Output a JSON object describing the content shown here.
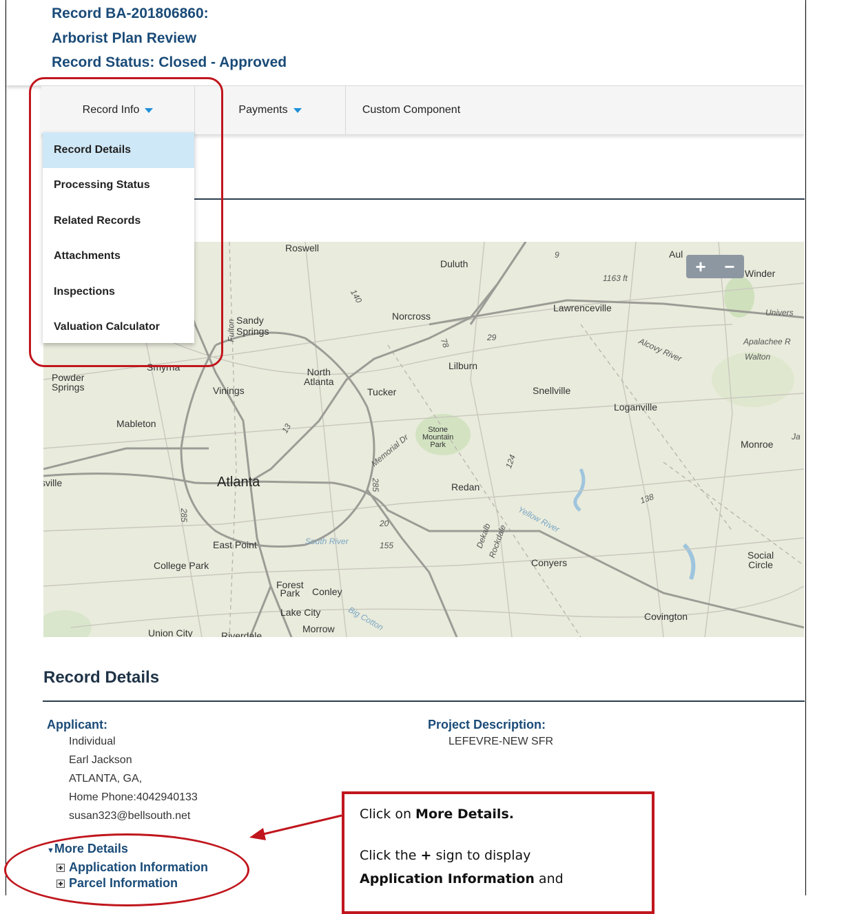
{
  "header": {
    "record_id": "Record BA-201806860:",
    "record_type": "Arborist Plan Review",
    "record_status": "Record Status: Closed - Approved"
  },
  "tabs": [
    {
      "label": "Record Info",
      "has_caret": true
    },
    {
      "label": "Payments",
      "has_caret": true
    },
    {
      "label": "Custom Component",
      "has_caret": false
    }
  ],
  "dropdown": {
    "items": [
      {
        "label": "Record Details",
        "active": true
      },
      {
        "label": "Processing Status"
      },
      {
        "label": "Related Records"
      },
      {
        "label": "Attachments"
      },
      {
        "label": "Inspections"
      },
      {
        "label": "Valuation Calculator"
      }
    ]
  },
  "map": {
    "labels": {
      "roswell": "Roswell",
      "duluth": "Duluth",
      "aul": "Aul",
      "winder": "Winder",
      "elev": "1163 ft",
      "lawrenceville": "Lawrenceville",
      "norcross": "Norcross",
      "sandy_springs": "Sandy\nSprings",
      "univers": "Univers",
      "apalachee": "Apalachee R",
      "walton": "Walton",
      "alcovy": "Alcovy River",
      "lilburn": "Lilburn",
      "smyrna": "Smyrna",
      "north_atlanta": "North\nAtlanta",
      "powder_springs": "Powder\nSprings",
      "vinings": "Vinings",
      "tucker": "Tucker",
      "snellville": "Snellville",
      "loganville": "Loganville",
      "mableton": "Mableton",
      "stone_mountain": "Stone\nMountain\nPark",
      "monroe": "Monroe",
      "ja": "Ja",
      "sville": "sville",
      "atlanta": "Atlanta",
      "redan": "Redan",
      "east_point": "East Point",
      "south_river": "South River",
      "yellow_river": "Yellow River",
      "college_park": "College Park",
      "conyers": "Conyers",
      "social_circle": "Social\nCircle",
      "forest_park": "Forest\nPark",
      "conley": "Conley",
      "lake_city": "Lake City",
      "covington": "Covington",
      "morrow": "Morrow",
      "union_city": "Union City",
      "riverdale": "Riverdale",
      "fulton": "Fulton",
      "dekalb": "Dekalb",
      "rockdale": "Rockdale",
      "memorial": "Memorial Dr",
      "big_cotton": "Big Cotton",
      "r285a": "285",
      "r285b": "285",
      "r20": "20",
      "r29": "29",
      "r78": "78",
      "r124": "124",
      "r138": "138",
      "r155": "155",
      "r13": "13",
      "r140": "140",
      "r9": "9"
    },
    "zoom_in": "+",
    "zoom_out": "−"
  },
  "record_details": {
    "title": "Record Details",
    "applicant_label": "Applicant:",
    "applicant_lines": [
      "Individual",
      "Earl Jackson",
      "ATLANTA, GA,",
      "Home Phone:4042940133",
      "susan323@bellsouth.net"
    ],
    "project_label": "Project Description:",
    "project_value": "LEFEVRE-NEW SFR",
    "more_details": "More Details",
    "application_information": "Application Information",
    "parcel_information": "Parcel Information"
  },
  "callout": {
    "line1_pre": "Click on ",
    "line1_bold": "More Details.",
    "line2_pre": "Click the ",
    "line2_bold": "+",
    "line2_post": " sign to display",
    "line3_bold": "Application Information",
    "line3_post": " and"
  },
  "colors": {
    "header_text": "#1a4b78",
    "tab_caret": "#1e90d9",
    "active_item_bg": "#cfe8f7",
    "annotation_red": "#c0161d",
    "map_bg": "#e9ebdc"
  }
}
